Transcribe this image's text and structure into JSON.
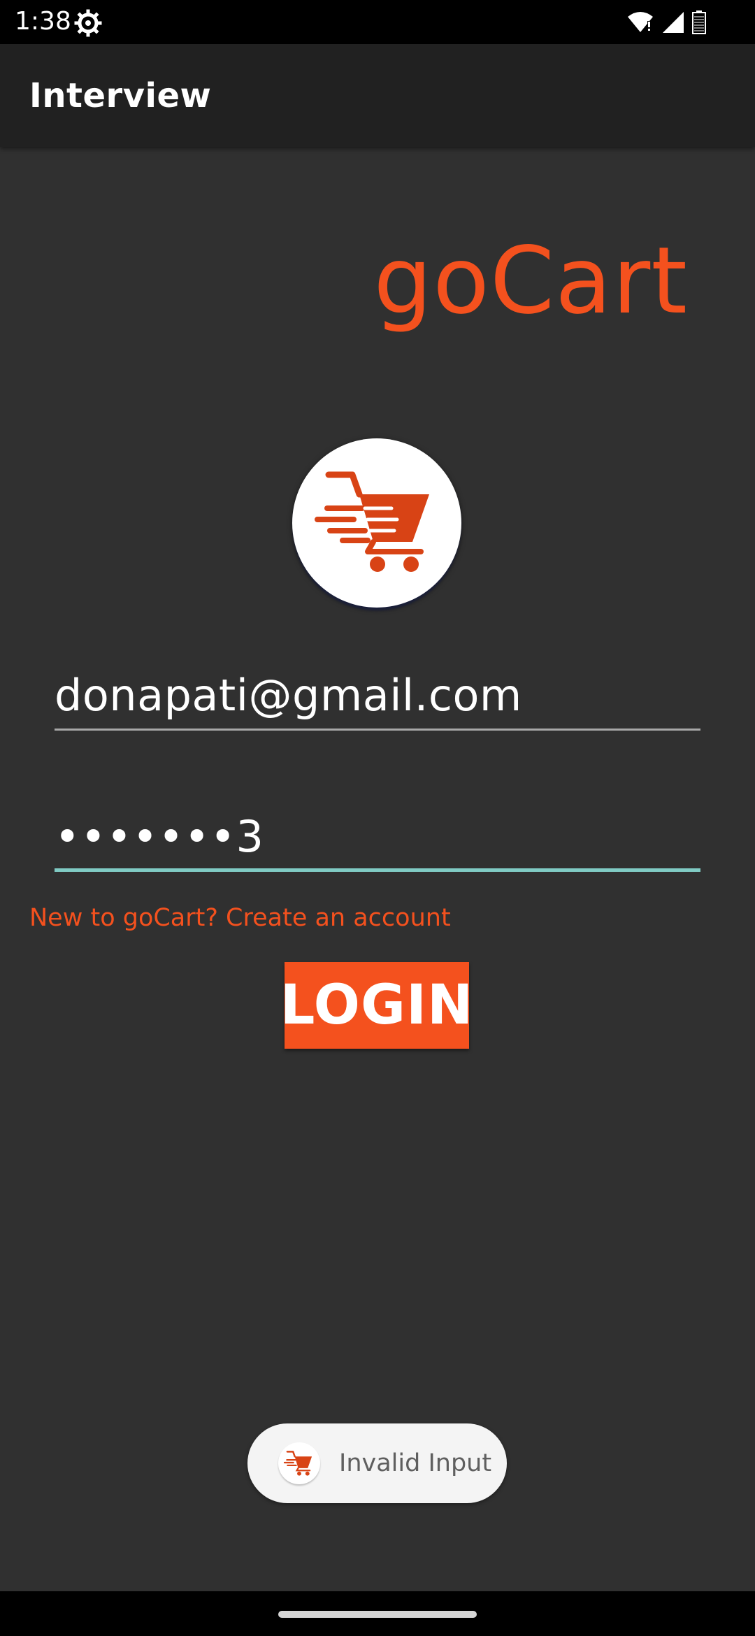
{
  "status_bar": {
    "time": "1:38",
    "icons": [
      "settings-gear-icon",
      "wifi-icon",
      "signal-icon",
      "battery-icon"
    ]
  },
  "app_bar": {
    "title": "Interview"
  },
  "brand": {
    "title": "goCart",
    "logo_icon": "shopping-cart-icon"
  },
  "login_form": {
    "email_value": "donapati@gmail.com",
    "password_value": "•••••••3",
    "signup_link": "New to goCart? Create an account",
    "login_button": "LOGIN"
  },
  "toast": {
    "icon": "shopping-cart-icon",
    "message": "Invalid Input"
  },
  "colors": {
    "accent": "#f4511e",
    "background": "#303030",
    "app_bar": "#212121",
    "focused_underline": "#80cbc4"
  }
}
